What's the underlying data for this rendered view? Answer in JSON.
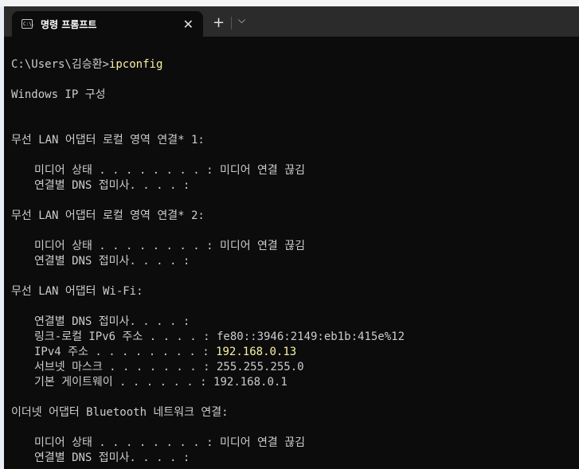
{
  "window": {
    "tab_title": "명령 프롬프트",
    "tab_icon_text": "C:\\."
  },
  "console": {
    "prompt": "C:\\Users\\김승환>",
    "command": "ipconfig",
    "header": "Windows IP 구성",
    "adapter1": {
      "title": "무선 LAN 어댑터 로컬 영역 연결* 1:",
      "media_state": "미디어 상태 . . . . . . . . : 미디어 연결 끊김",
      "dns_suffix": "연결별 DNS 접미사. . . . :"
    },
    "adapter2": {
      "title": "무선 LAN 어댑터 로컬 영역 연결* 2:",
      "media_state": "미디어 상태 . . . . . . . . : 미디어 연결 끊김",
      "dns_suffix": "연결별 DNS 접미사. . . . :"
    },
    "wifi": {
      "title": "무선 LAN 어댑터 Wi-Fi:",
      "dns_suffix": "연결별 DNS 접미사. . . . :",
      "ipv6_label": "링크-로컬 IPv6 주소 . . . . : ",
      "ipv6_value": "fe80::3946:2149:eb1b:415e%12",
      "ipv4_label": "IPv4 주소 . . . . . . . . : ",
      "ipv4_value": "192.168.0.13",
      "subnet_label": "서브넷 마스크 . . . . . . . : ",
      "subnet_value": "255.255.255.0",
      "gateway_label": "기본 게이트웨이 . . . . . . : ",
      "gateway_value": "192.168.0.1"
    },
    "bluetooth": {
      "title": "이더넷 어댑터 Bluetooth 네트워크 연결:",
      "media_state": "미디어 상태 . . . . . . . . : 미디어 연결 끊김",
      "dns_suffix": "연결별 DNS 접미사. . . . :"
    }
  },
  "colors": {
    "background": "#0c0c0c",
    "text": "#cccccc",
    "highlight": "#f9f1a5",
    "titlebar": "#2b2b2b"
  }
}
